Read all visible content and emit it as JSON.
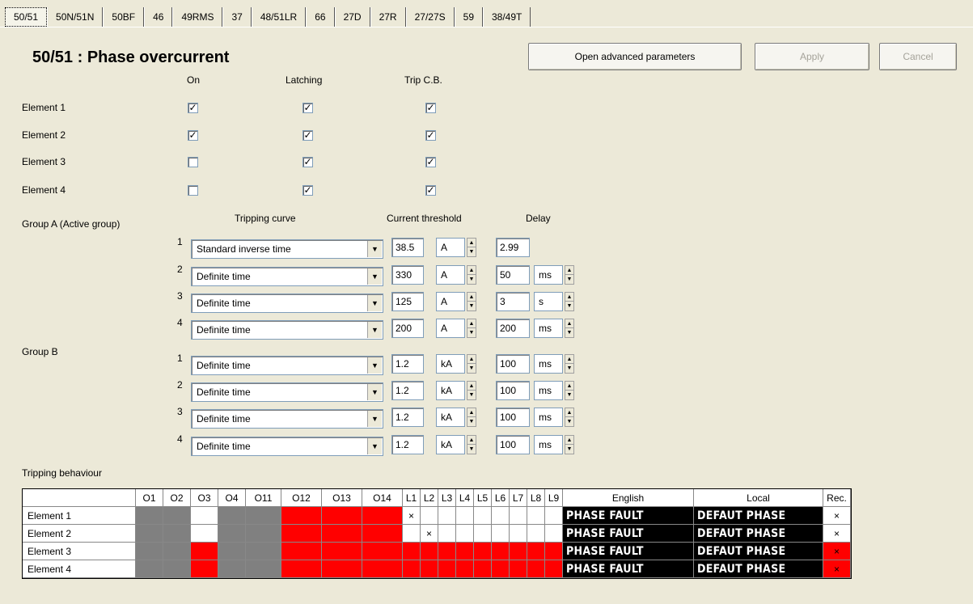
{
  "tabs": [
    "50/51",
    "50N/51N",
    "50BF",
    "46",
    "49RMS",
    "37",
    "48/51LR",
    "66",
    "27D",
    "27R",
    "27/27S",
    "59",
    "38/49T"
  ],
  "title": "50/51 : Phase overcurrent",
  "buttons": {
    "advanced": "Open advanced parameters",
    "apply": "Apply",
    "cancel": "Cancel"
  },
  "elements_table": {
    "headers": [
      "On",
      "Latching",
      "Trip C.B."
    ],
    "rows": [
      {
        "label": "Element 1",
        "on": true,
        "latching": true,
        "trip": true
      },
      {
        "label": "Element 2",
        "on": true,
        "latching": true,
        "trip": true
      },
      {
        "label": "Element 3",
        "on": false,
        "latching": true,
        "trip": true
      },
      {
        "label": "Element 4",
        "on": false,
        "latching": true,
        "trip": true
      }
    ]
  },
  "settings": {
    "headers": {
      "curve": "Tripping curve",
      "threshold": "Current threshold",
      "delay": "Delay"
    },
    "group_a_label": "Group A  (Active group)",
    "group_b_label": "Group B",
    "group_a": [
      {
        "num": "1",
        "curve": "Standard inverse time",
        "threshold": "38.5",
        "unit": "A",
        "delay": "2.99",
        "delay_unit": ""
      },
      {
        "num": "2",
        "curve": "Definite time",
        "threshold": "330",
        "unit": "A",
        "delay": "50",
        "delay_unit": "ms"
      },
      {
        "num": "3",
        "curve": "Definite time",
        "threshold": "125",
        "unit": "A",
        "delay": "3",
        "delay_unit": "s"
      },
      {
        "num": "4",
        "curve": "Definite time",
        "threshold": "200",
        "unit": "A",
        "delay": "200",
        "delay_unit": "ms"
      }
    ],
    "group_b": [
      {
        "num": "1",
        "curve": "Definite time",
        "threshold": "1.2",
        "unit": "kA",
        "delay": "100",
        "delay_unit": "ms"
      },
      {
        "num": "2",
        "curve": "Definite time",
        "threshold": "1.2",
        "unit": "kA",
        "delay": "100",
        "delay_unit": "ms"
      },
      {
        "num": "3",
        "curve": "Definite time",
        "threshold": "1.2",
        "unit": "kA",
        "delay": "100",
        "delay_unit": "ms"
      },
      {
        "num": "4",
        "curve": "Definite time",
        "threshold": "1.2",
        "unit": "kA",
        "delay": "100",
        "delay_unit": "ms"
      }
    ]
  },
  "tripping": {
    "label": "Tripping behaviour",
    "columns": [
      "O1",
      "O2",
      "O3",
      "O4",
      "O11",
      "O12",
      "O13",
      "O14",
      "L1",
      "L2",
      "L3",
      "L4",
      "L5",
      "L6",
      "L7",
      "L8",
      "L9",
      "English",
      "Local",
      "Rec."
    ],
    "rows": [
      {
        "label": "Element 1",
        "cells": [
          "gray",
          "gray",
          "white",
          "gray",
          "gray",
          "red",
          "red",
          "red",
          "white",
          "white",
          "white",
          "white",
          "white",
          "white",
          "white",
          "white",
          "white"
        ],
        "marks": [
          "",
          "",
          "",
          "",
          "",
          "",
          "",
          "",
          "×",
          "",
          "",
          "",
          "",
          "",
          "",
          "",
          ""
        ],
        "english": "PHASE FAULT",
        "local": "DEFAUT PHASE",
        "rec": "×",
        "rec_color": "white"
      },
      {
        "label": "Element 2",
        "cells": [
          "gray",
          "gray",
          "white",
          "gray",
          "gray",
          "red",
          "red",
          "red",
          "white",
          "white",
          "white",
          "white",
          "white",
          "white",
          "white",
          "white",
          "white"
        ],
        "marks": [
          "",
          "",
          "",
          "",
          "",
          "",
          "",
          "",
          "",
          "×",
          "",
          "",
          "",
          "",
          "",
          "",
          ""
        ],
        "english": "PHASE FAULT",
        "local": "DEFAUT PHASE",
        "rec": "×",
        "rec_color": "white"
      },
      {
        "label": "Element 3",
        "cells": [
          "gray",
          "gray",
          "red",
          "gray",
          "gray",
          "red",
          "red",
          "red",
          "red",
          "red",
          "red",
          "red",
          "red",
          "red",
          "red",
          "red",
          "red"
        ],
        "marks": [
          "",
          "",
          "",
          "",
          "",
          "",
          "",
          "",
          "",
          "",
          "",
          "",
          "",
          "",
          "",
          "",
          ""
        ],
        "english": "PHASE FAULT",
        "local": "DEFAUT PHASE",
        "rec": "×",
        "rec_color": "red"
      },
      {
        "label": "Element 4",
        "cells": [
          "gray",
          "gray",
          "red",
          "gray",
          "gray",
          "red",
          "red",
          "red",
          "red",
          "red",
          "red",
          "red",
          "red",
          "red",
          "red",
          "red",
          "red"
        ],
        "marks": [
          "",
          "",
          "",
          "",
          "",
          "",
          "",
          "",
          "",
          "",
          "",
          "",
          "",
          "",
          "",
          "",
          ""
        ],
        "english": "PHASE FAULT",
        "local": "DEFAUT PHASE",
        "rec": "×",
        "rec_color": "red"
      }
    ]
  },
  "colors": {
    "gray_cell": "#808080",
    "red_cell": "#ff0000",
    "background": "#ece9d8"
  }
}
